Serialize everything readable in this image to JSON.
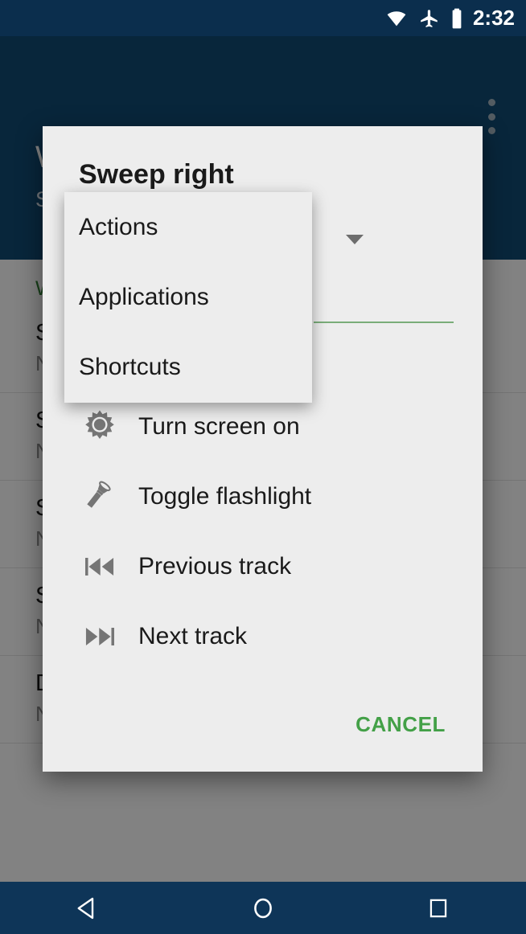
{
  "status_bar": {
    "time": "2:32",
    "icons": [
      "wifi-icon",
      "airplane-mode-icon",
      "battery-icon"
    ]
  },
  "app_bar": {
    "title": "Wave Control",
    "subtitle": "Settings",
    "overflow_label": "more-options",
    "background_color": "#114a72"
  },
  "background_list": {
    "section_header": "Wave actions",
    "rows": [
      {
        "title": "Sweep left",
        "subtitle": "No Action"
      },
      {
        "title": "Sweep right",
        "subtitle": "No Action"
      },
      {
        "title": "Sweep up",
        "subtitle": "No Action"
      },
      {
        "title": "Sweep down",
        "subtitle": "No Action"
      },
      {
        "title": "Double tap",
        "subtitle": "No Action"
      }
    ]
  },
  "dialog": {
    "title": "Sweep right",
    "spinner": {
      "selected": "Actions",
      "arrow": "chevron-down-icon",
      "underline_color": "#7aad79",
      "options": [
        "Actions",
        "Applications",
        "Shortcuts"
      ]
    },
    "actions": [
      {
        "icon": "sun-icon",
        "label": "Turn screen on"
      },
      {
        "icon": "flashlight-icon",
        "label": "Toggle flashlight"
      },
      {
        "icon": "previous-track-icon",
        "label": "Previous track"
      },
      {
        "icon": "next-track-icon",
        "label": "Next track"
      }
    ],
    "cancel_label": "CANCEL",
    "cancel_color": "#43a047"
  },
  "dropdown_popup": {
    "items": [
      "Actions",
      "Applications",
      "Shortcuts"
    ]
  },
  "nav_bar": {
    "buttons": [
      "back-button",
      "home-button",
      "recents-button"
    ],
    "background_color": "#0e3558"
  }
}
